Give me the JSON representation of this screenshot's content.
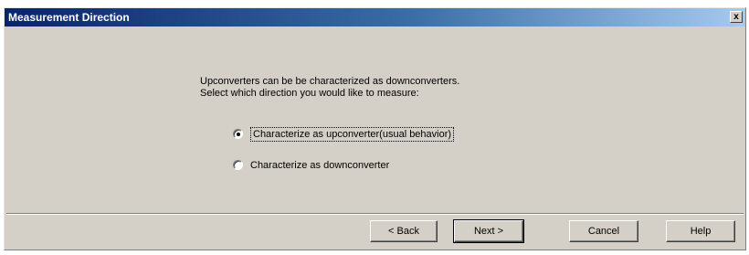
{
  "window": {
    "title": "Measurement Direction",
    "close_glyph": "x"
  },
  "message": {
    "line1": "Upconverters can be be characterized as downconverters.",
    "line2": "Select which direction you would like to measure:"
  },
  "options": [
    {
      "label": "Characterize as upconverter(usual behavior)",
      "selected": true
    },
    {
      "label": "Characterize as downconverter",
      "selected": false
    }
  ],
  "buttons": {
    "back": "< Back",
    "next": "Next >",
    "cancel": "Cancel",
    "help": "Help"
  },
  "colors": {
    "title_start": "#0a246a",
    "title_end": "#a6caf0",
    "dialog_bg": "#d4d0c8"
  }
}
